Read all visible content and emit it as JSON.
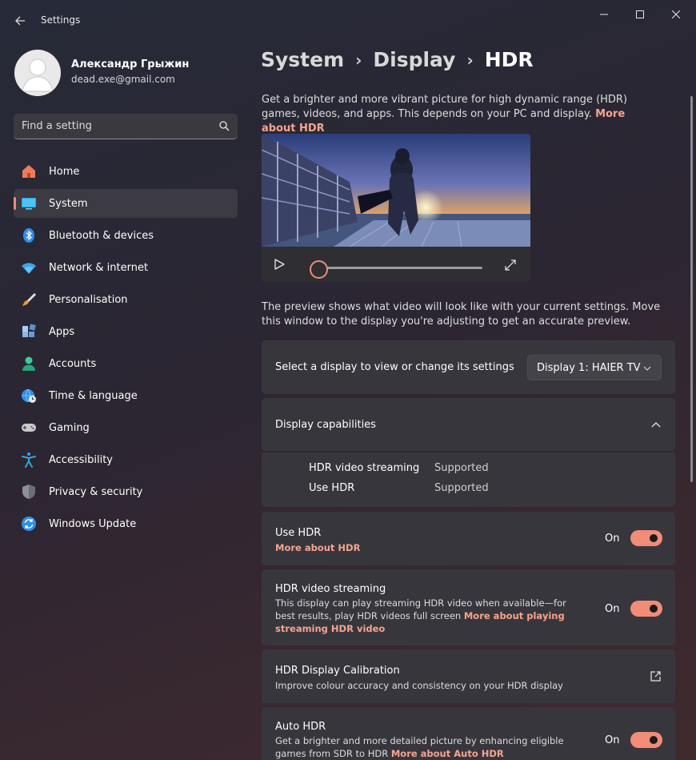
{
  "app": {
    "title": "Settings"
  },
  "user": {
    "name": "Александр Грыжин",
    "email": "dead.exe@gmail.com"
  },
  "search": {
    "placeholder": "Find a setting"
  },
  "nav": [
    {
      "label": "Home",
      "icon": "home-icon",
      "active": false
    },
    {
      "label": "System",
      "icon": "system-icon",
      "active": true
    },
    {
      "label": "Bluetooth & devices",
      "icon": "bluetooth-icon",
      "active": false
    },
    {
      "label": "Network & internet",
      "icon": "wifi-icon",
      "active": false
    },
    {
      "label": "Personalisation",
      "icon": "brush-icon",
      "active": false
    },
    {
      "label": "Apps",
      "icon": "apps-icon",
      "active": false
    },
    {
      "label": "Accounts",
      "icon": "accounts-icon",
      "active": false
    },
    {
      "label": "Time & language",
      "icon": "globe-clock-icon",
      "active": false
    },
    {
      "label": "Gaming",
      "icon": "gamepad-icon",
      "active": false
    },
    {
      "label": "Accessibility",
      "icon": "accessibility-icon",
      "active": false
    },
    {
      "label": "Privacy & security",
      "icon": "shield-icon",
      "active": false
    },
    {
      "label": "Windows Update",
      "icon": "update-icon",
      "active": false
    }
  ],
  "breadcrumb": {
    "level1": "System",
    "level2": "Display",
    "current": "HDR"
  },
  "intro": {
    "text": "Get a brighter and more vibrant picture for high dynamic range (HDR) games, videos, and apps. This depends on your PC and display.",
    "link": "More about HDR"
  },
  "preview": {
    "note": "The preview shows what video will look like with your current settings. Move this window to the display you're adjusting to get an accurate preview.",
    "progress": 0
  },
  "display_select": {
    "label": "Select a display to view or change its settings",
    "value": "Display 1: HAIER TV"
  },
  "capabilities": {
    "title": "Display capabilities",
    "rows": [
      {
        "name": "HDR video streaming",
        "value": "Supported"
      },
      {
        "name": "Use HDR",
        "value": "Supported"
      }
    ]
  },
  "use_hdr": {
    "title": "Use HDR",
    "link": "More about HDR",
    "state": "On"
  },
  "hdr_streaming": {
    "title": "HDR video streaming",
    "desc": "This display can play streaming HDR video when available—for best results, play HDR videos full screen",
    "link": "More about playing streaming HDR video",
    "state": "On"
  },
  "calibration": {
    "title": "HDR Display Calibration",
    "desc": "Improve colour accuracy and consistency on your HDR display"
  },
  "auto_hdr": {
    "title": "Auto HDR",
    "desc": "Get a brighter and more detailed picture by enhancing eligible games from SDR to HDR",
    "link": "More about Auto HDR",
    "state": "On"
  },
  "colors": {
    "accent": "#f08c78",
    "link": "#f6a48e"
  }
}
